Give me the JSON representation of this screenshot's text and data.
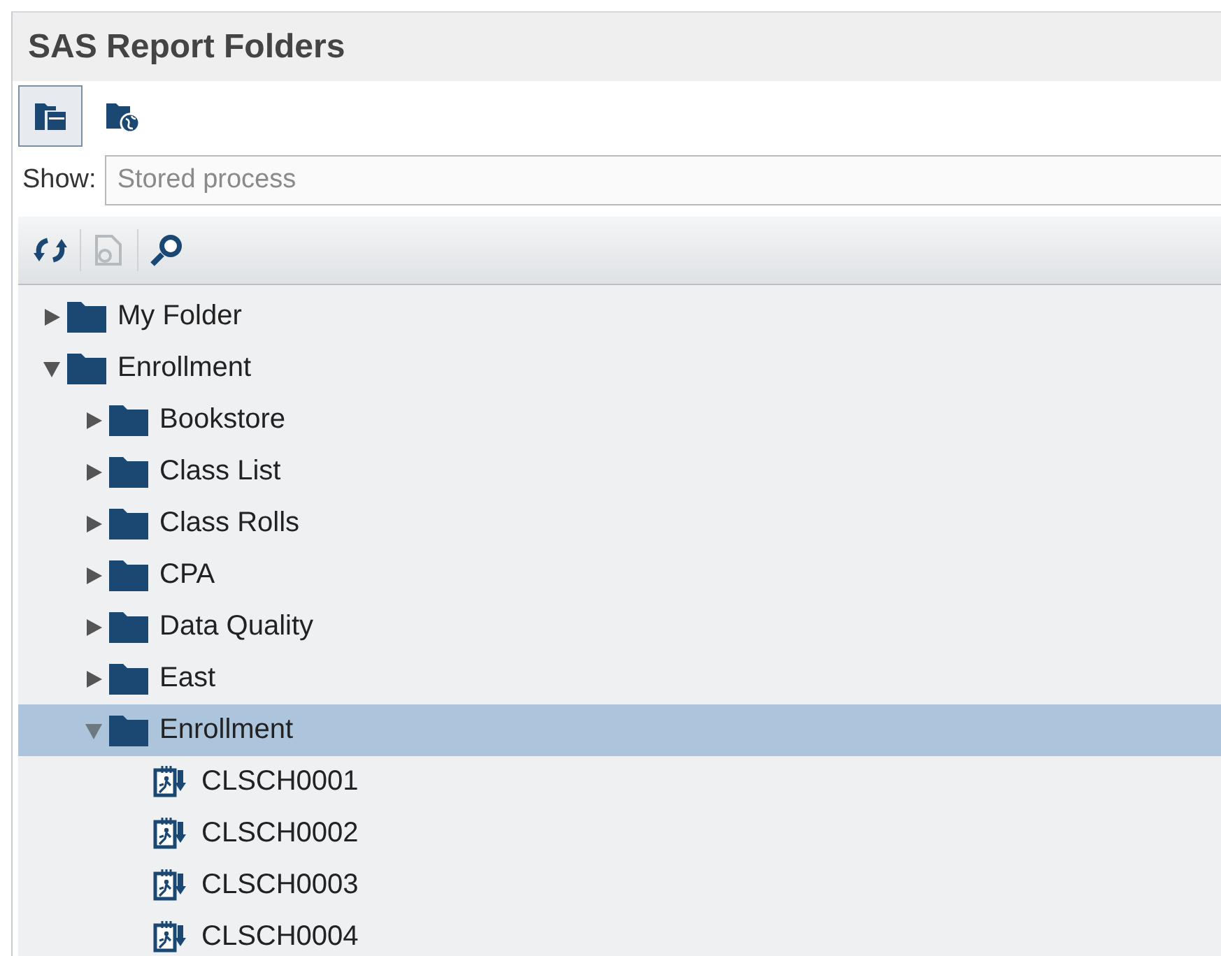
{
  "panel": {
    "title": "SAS Report Folders"
  },
  "view_buttons": [
    {
      "kind": "folders",
      "selected": true
    },
    {
      "kind": "shared",
      "selected": false
    }
  ],
  "show": {
    "label": "Show:",
    "value": "Stored process",
    "disabled": true
  },
  "tree_toolbar": [
    {
      "kind": "refresh",
      "disabled": false
    },
    {
      "kind": "properties",
      "disabled": true
    },
    {
      "kind": "search",
      "disabled": false
    }
  ],
  "tree": [
    {
      "kind": "folder",
      "label": "My Folder",
      "expanded": false,
      "selected": false
    },
    {
      "kind": "folder",
      "label": "Enrollment",
      "expanded": true,
      "selected": false,
      "children": [
        {
          "kind": "folder",
          "label": "Bookstore",
          "expanded": false,
          "selected": false
        },
        {
          "kind": "folder",
          "label": "Class List",
          "expanded": false,
          "selected": false
        },
        {
          "kind": "folder",
          "label": "Class Rolls",
          "expanded": false,
          "selected": false
        },
        {
          "kind": "folder",
          "label": "CPA",
          "expanded": false,
          "selected": false
        },
        {
          "kind": "folder",
          "label": "Data Quality",
          "expanded": false,
          "selected": false
        },
        {
          "kind": "folder",
          "label": "East",
          "expanded": false,
          "selected": false
        },
        {
          "kind": "folder",
          "label": "Enrollment",
          "expanded": true,
          "selected": true,
          "children": [
            {
              "kind": "report",
              "label": "CLSCH0001",
              "selected": false
            },
            {
              "kind": "report",
              "label": "CLSCH0002",
              "selected": false
            },
            {
              "kind": "report",
              "label": "CLSCH0003",
              "selected": false
            },
            {
              "kind": "report",
              "label": "CLSCH0004",
              "selected": false
            }
          ]
        }
      ]
    }
  ]
}
